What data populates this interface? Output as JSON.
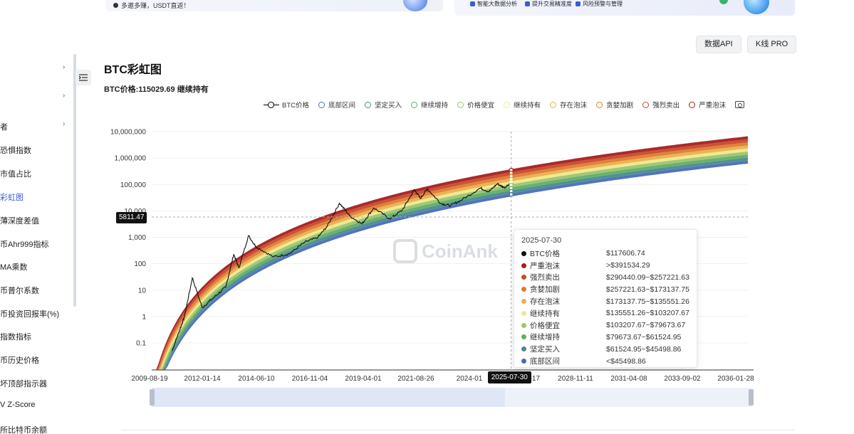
{
  "banner": {
    "left_text": "多邀多赚，USDT直返！",
    "features": [
      "智能大数据分析",
      "提升交易精准度",
      "风险预警与管理"
    ]
  },
  "buttons": {
    "data_api": "数据API",
    "kline_pro": "K线 PRO"
  },
  "sidebar": {
    "items": [
      {
        "label": "",
        "chevron": true
      },
      {
        "label": "",
        "chevron": true
      },
      {
        "label": "者",
        "chevron": true
      },
      {
        "label": "恐惧指数"
      },
      {
        "label": "市值占比"
      },
      {
        "label": "彩虹图",
        "active": true
      },
      {
        "label": "薄深度差值"
      },
      {
        "label": "币Ahr999指标"
      },
      {
        "label": "MA乘数"
      },
      {
        "label": "币普尔系数"
      },
      {
        "label": "币投资回报率(%)"
      },
      {
        "label": "指数指标"
      },
      {
        "label": "币历史价格"
      },
      {
        "label": "坏顶部指示器"
      },
      {
        "label": "V Z-Score"
      },
      {
        "label": "所比特币余额"
      }
    ]
  },
  "page": {
    "title": "BTC彩虹图",
    "subtitle": "BTC价格:115029.69 继续持有"
  },
  "legend": {
    "btc": "BTC价格",
    "bands": [
      {
        "name": "底部区间",
        "color": "#4a6bb8"
      },
      {
        "name": "坚定买入",
        "color": "#4a8a8e"
      },
      {
        "name": "继续增持",
        "color": "#5fae66"
      },
      {
        "name": "价格便宜",
        "color": "#9cc46e"
      },
      {
        "name": "继续持有",
        "color": "#efe88a"
      },
      {
        "name": "存在泡沫",
        "color": "#e9b04e"
      },
      {
        "name": "贪婪加剧",
        "color": "#e07a2f"
      },
      {
        "name": "强烈卖出",
        "color": "#c9482a"
      },
      {
        "name": "严重泡沫",
        "color": "#a4201c"
      }
    ]
  },
  "chart_data": {
    "type": "line",
    "title": "BTC彩虹图",
    "y_scale": "log",
    "ylim": [
      0.01,
      10000000
    ],
    "y_ticks": [
      "0.1",
      "1",
      "10",
      "100",
      "1,000",
      "10,000",
      "100,000",
      "1,000,000",
      "10,000,000"
    ],
    "x_ticks": [
      "2009-08-19",
      "2012-01-14",
      "2014-06-10",
      "2016-11-04",
      "2019-04-01",
      "2021-08-26",
      "2024-01",
      "2025-07-30",
      "6-17",
      "2028-11-11",
      "2031-04-08",
      "2033-09-02",
      "2036-01-28"
    ],
    "x_range": [
      "2009-08-19",
      "2036-01-28"
    ],
    "band_colors": [
      "#4a6bb8",
      "#4a8a8e",
      "#5fae66",
      "#9cc46e",
      "#efe88a",
      "#e9b04e",
      "#e07a2f",
      "#c9482a",
      "#a4201c"
    ],
    "btc_price": {
      "name": "BTC价格",
      "points": [
        [
          "2010-07-15",
          0.05
        ],
        [
          "2010-11-01",
          0.25
        ],
        [
          "2011-02-01",
          1.0
        ],
        [
          "2011-06-08",
          29
        ],
        [
          "2011-11-15",
          2.2
        ],
        [
          "2012-06-01",
          5.5
        ],
        [
          "2012-12-01",
          13
        ],
        [
          "2013-04-09",
          230
        ],
        [
          "2013-07-01",
          70
        ],
        [
          "2013-12-04",
          1150
        ],
        [
          "2014-04-01",
          450
        ],
        [
          "2015-01-14",
          180
        ],
        [
          "2015-10-01",
          240
        ],
        [
          "2016-06-01",
          650
        ],
        [
          "2017-01-01",
          1000
        ],
        [
          "2017-06-01",
          2600
        ],
        [
          "2017-12-17",
          19500
        ],
        [
          "2018-06-01",
          6500
        ],
        [
          "2018-12-15",
          3200
        ],
        [
          "2019-06-26",
          12900
        ],
        [
          "2020-03-12",
          5000
        ],
        [
          "2020-10-01",
          10800
        ],
        [
          "2021-04-14",
          64000
        ],
        [
          "2021-07-20",
          29800
        ],
        [
          "2021-11-10",
          68000
        ],
        [
          "2022-06-18",
          19000
        ],
        [
          "2022-11-21",
          15800
        ],
        [
          "2023-06-01",
          27000
        ],
        [
          "2024-03-14",
          73000
        ],
        [
          "2024-08-05",
          54000
        ],
        [
          "2024-12-17",
          106000
        ],
        [
          "2025-04-08",
          76000
        ],
        [
          "2025-07-30",
          117606.74
        ]
      ]
    },
    "crosshair": {
      "date": "2025-07-30",
      "y_label": "5811.47"
    },
    "tooltip": {
      "date": "2025-07-30",
      "rows": [
        {
          "name": "BTC价格",
          "value": "$117606.74",
          "color": "#111111"
        },
        {
          "name": "严重泡沫",
          "value": ">$391534.29",
          "color": "#a4201c"
        },
        {
          "name": "强烈卖出",
          "value": "$290440.09~$257221.63",
          "color": "#c9482a"
        },
        {
          "name": "贪婪加剧",
          "value": "$257221.63~$173137.75",
          "color": "#e07a2f"
        },
        {
          "name": "存在泡沫",
          "value": "$173137.75~$135551.26",
          "color": "#e9b04e"
        },
        {
          "name": "继续持有",
          "value": "$135551.26~$103207.67",
          "color": "#efe88a"
        },
        {
          "name": "价格便宜",
          "value": "$103207.67~$79673.67",
          "color": "#9cc46e"
        },
        {
          "name": "继续增持",
          "value": "$79673.67~$61524.95",
          "color": "#5fae66"
        },
        {
          "name": "坚定买入",
          "value": "$61524.95~$45498.86",
          "color": "#4a8a8e"
        },
        {
          "name": "底部区间",
          "value": "<$45498.86",
          "color": "#4a6bb8"
        }
      ]
    }
  },
  "watermark": "CoinAnk"
}
